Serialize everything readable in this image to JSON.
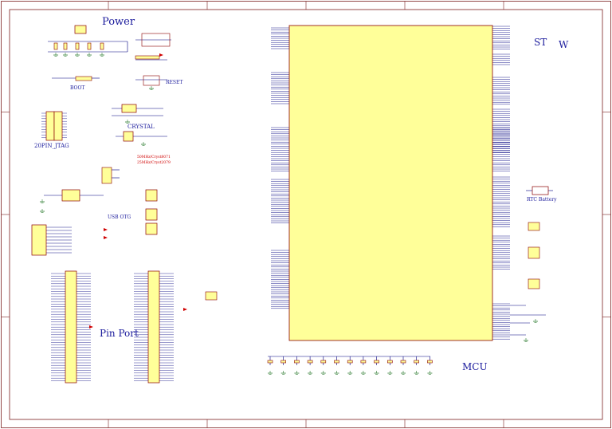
{
  "sheet": {
    "colors": {
      "border": "#7a1e1e",
      "wire": "#000080",
      "component_fill": "#ffff99",
      "component_stroke": "#8b0000",
      "label": "#1a1a9c",
      "alert": "#d00000",
      "ground": "#2e7d32"
    }
  },
  "sections": {
    "power": "Power",
    "boot": "BOOT",
    "reset": "RESET",
    "jtag": "20PIN_JTAG",
    "crystal": "CRYSTAL",
    "crystal_note1": "50MHz/Cryst8071",
    "crystal_note2": "25MHz/Cryst2079",
    "usb_otg": "USB OTG",
    "pin_port": "Pin Port",
    "mcu": "MCU",
    "rtc_battery": "RTC Battery",
    "title_st": "ST",
    "title_w": "W"
  },
  "icons": {
    "ground": "ground-symbol-icon",
    "power": "power-rail-icon",
    "arrow": "net-arrow-icon"
  }
}
